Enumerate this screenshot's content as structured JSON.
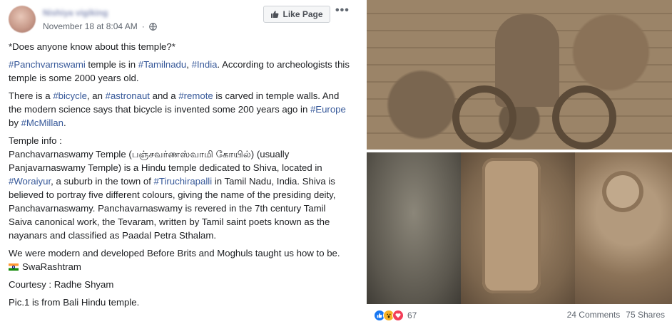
{
  "header": {
    "author": "Nishiya vigiking",
    "timestamp": "November 18 at 8:04 AM",
    "dot": "·",
    "like_page_label": "Like Page",
    "more_label": "•••"
  },
  "post": {
    "question": "*Does anyone know about this temple?*",
    "p1": {
      "tag1": "#Panchvarnswami",
      "t1": " temple is in ",
      "tag2": "#Tamilnadu",
      "t2": ", ",
      "tag3": "#India",
      "t3": ". According to archeologists this temple is some 2000 years old."
    },
    "p2": {
      "t1": "There is a ",
      "tag1": "#bicycle",
      "t2": ", an ",
      "tag2": "#astronaut",
      "t3": " and a ",
      "tag3": "#remote",
      "t4": " is carved in temple walls. And the modern science says that bicycle is invented some 200 years ago in ",
      "tag4": "#Europe",
      "t5": " by ",
      "tag5": "#McMillan",
      "t6": "."
    },
    "p3": {
      "heading": "Temple info :",
      "t1": "Panchavarnaswamy Temple (பஞ்சவர்ணஸ்வாமி கோயில்) (usually Panjavarnaswamy Temple) is a Hindu temple dedicated to Shiva, located in ",
      "tag1": "#Woraiyur",
      "t2": ", a suburb in the town of ",
      "tag2": "#Tiruchirapalli",
      "t3": " in Tamil Nadu, India. Shiva is believed to portray five different colours, giving the name of the presiding deity, Panchavarnaswamy. Panchavarnaswamy is revered in the 7th century Tamil Saiva canonical work, the Tevaram, written by Tamil saint poets known as the nayanars and classified as Paadal Petra Sthalam."
    },
    "p4": "We were modern and developed Before Brits and Moghuls taught us how to be.",
    "p4_sign": "SwaRashtram",
    "p5": "Courtesy : Radhe Shyam",
    "p6": "Pic.1 is from Bali Hindu temple."
  },
  "footer": {
    "reaction_count": "67",
    "comments": "24 Comments",
    "shares": "75 Shares"
  },
  "colors": {
    "link": "#365899",
    "like_blue": "#1877f2",
    "love_red": "#f33e58",
    "wow_yellow": "#f7b125"
  },
  "icons": [
    "globe-icon",
    "thumbs-up-icon",
    "india-flag-icon",
    "like-reaction-icon",
    "wow-reaction-icon",
    "love-reaction-icon"
  ]
}
